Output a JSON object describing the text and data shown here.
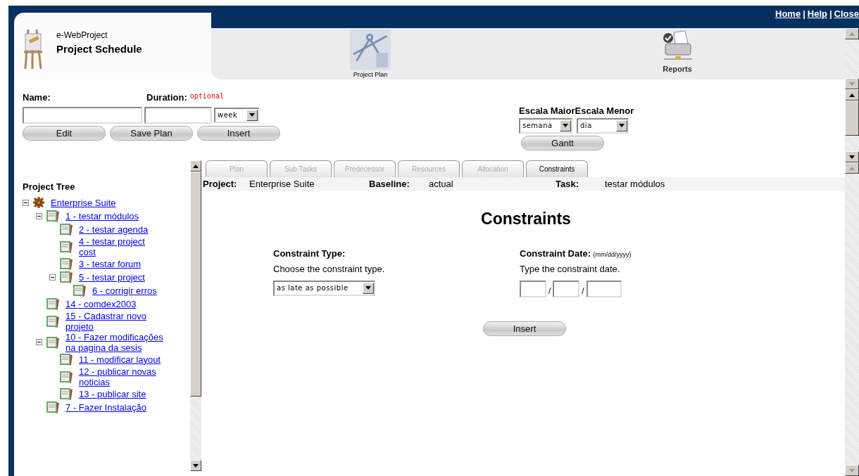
{
  "header": {
    "links": [
      "Home",
      "Help",
      "Close"
    ],
    "separator": "|",
    "app_name": "e-WebProject",
    "title": "Project Schedule",
    "toolbar": [
      {
        "label": "Project Plan",
        "kind": "plan"
      },
      {
        "label": "Reports",
        "kind": "reports"
      }
    ]
  },
  "form": {
    "name_label": "Name:",
    "duration_label": "Duration:",
    "duration_hint": "optional",
    "unit": "week",
    "buttons": [
      "Edit",
      "Save Plan",
      "Insert"
    ],
    "major_scale_label": "Escala Maior",
    "minor_scale_label": "Escala Menor",
    "major_scale": "semana",
    "minor_scale": "dia",
    "gantt_button": "Gantt"
  },
  "tree": {
    "title": "Project Tree",
    "items": [
      {
        "label": "Enterprise Suite",
        "kind": "project",
        "expanded": true,
        "children": [
          {
            "label": "1 - testar módulos",
            "kind": "task",
            "expanded": true,
            "children": [
              {
                "label": "2 - testar agenda",
                "kind": "task"
              },
              {
                "label": "4 - testar project cost",
                "kind": "task"
              },
              {
                "label": "3 - testar forum",
                "kind": "task"
              },
              {
                "label": "5 - testar project",
                "kind": "task",
                "expanded": true,
                "children": [
                  {
                    "label": "6 - corrigir erros",
                    "kind": "task"
                  }
                ]
              }
            ]
          },
          {
            "label": "14 - comdex2003",
            "kind": "task"
          },
          {
            "label": "15 - Cadastrar novo projeto",
            "kind": "task"
          },
          {
            "label": "10 - Fazer modificações na pagina da sesis",
            "kind": "task",
            "expanded": true,
            "children": [
              {
                "label": "11 - modificar layout",
                "kind": "task"
              },
              {
                "label": "12 - publicar novas noticias",
                "kind": "task"
              },
              {
                "label": "13 - publicar site",
                "kind": "task"
              }
            ]
          },
          {
            "label": "7 - Fazer Instalação",
            "kind": "task"
          }
        ]
      }
    ]
  },
  "tabs": [
    {
      "label": "Plan",
      "selected": false
    },
    {
      "label": "Sub Tasks",
      "selected": false
    },
    {
      "label": "Predecessor",
      "selected": false
    },
    {
      "label": "Resources",
      "selected": false
    },
    {
      "label": "Allocation",
      "selected": false
    },
    {
      "label": "Constraints",
      "selected": true
    }
  ],
  "info": [
    {
      "label": "Project:",
      "value": "Enterprise Suite"
    },
    {
      "label": "Baseline:",
      "value": "actual"
    },
    {
      "label": "Task:",
      "value": "testar módulos"
    }
  ],
  "constraints": {
    "heading": "Constraints",
    "type_label": "Constraint Type:",
    "type_help": "Choose the constraint type.",
    "type_value": "as late as possible",
    "date_label": "Constraint Date:",
    "date_format": "(mm/dd/yyyy)",
    "date_help": "Type the constraint date.",
    "date_separator": "/",
    "button": "Insert"
  }
}
